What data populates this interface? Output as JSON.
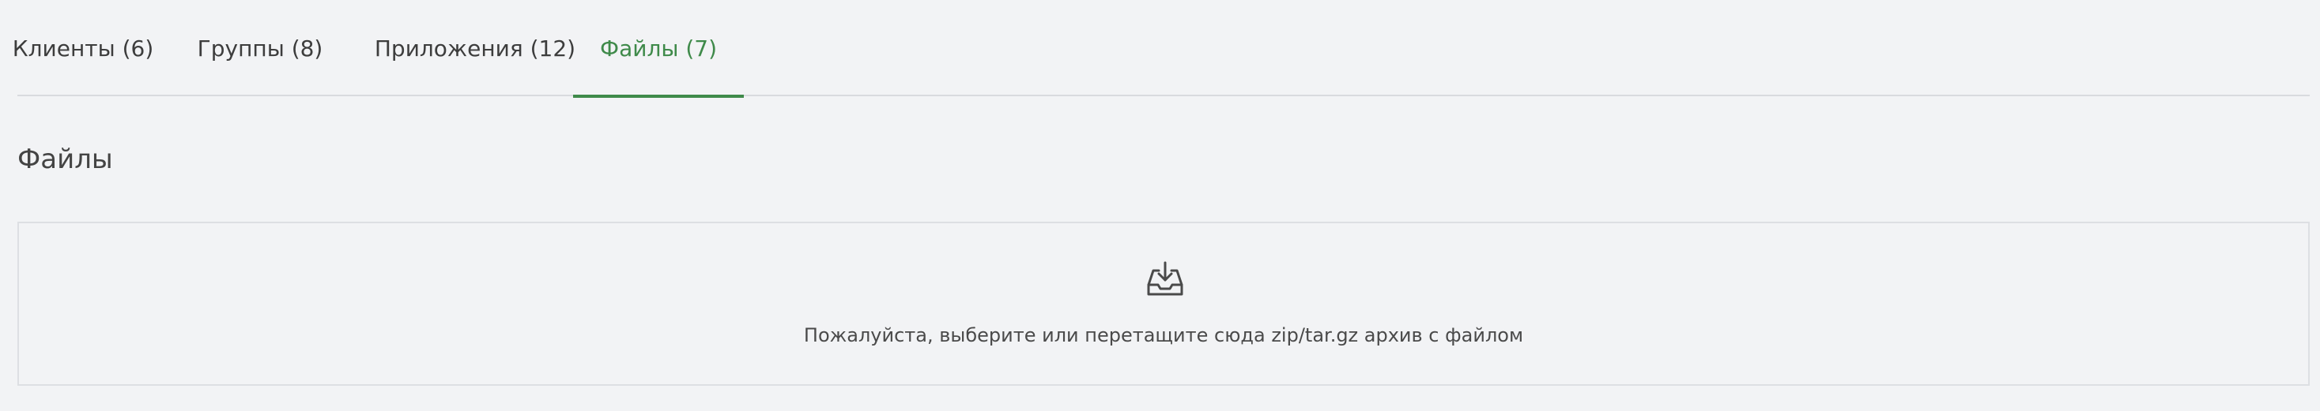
{
  "tabs": [
    {
      "label": "Клиенты (6)",
      "active": false
    },
    {
      "label": "Группы (8)",
      "active": false
    },
    {
      "label": "Приложения (12)",
      "active": false
    },
    {
      "label": "Файлы (7)",
      "active": true
    }
  ],
  "section": {
    "title": "Файлы"
  },
  "dropzone": {
    "icon": "upload-tray-icon",
    "text": "Пожалуйста, выберите или перетащите сюда zip/tar.gz архив с файлом"
  },
  "colors": {
    "accent": "#3f8a4a",
    "background": "#f2f3f5",
    "border": "#d8dade"
  }
}
